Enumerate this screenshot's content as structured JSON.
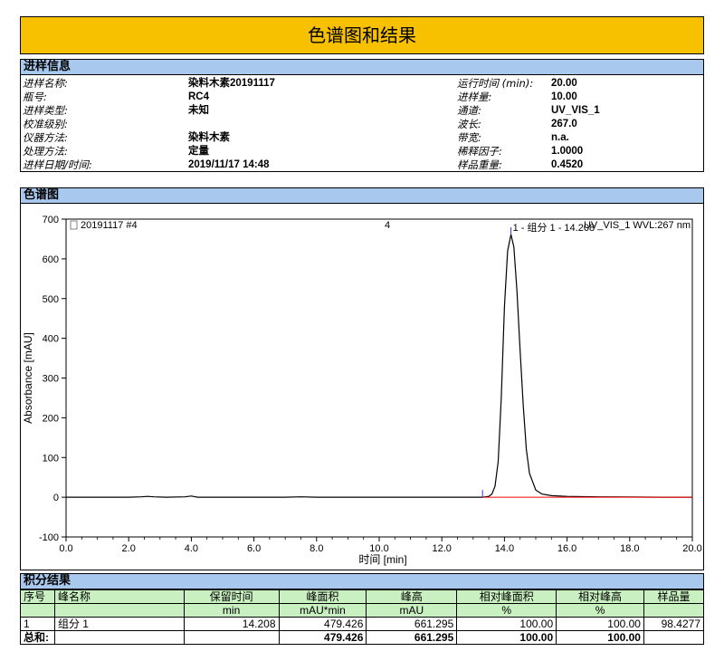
{
  "report": {
    "title": "色谱图和结果"
  },
  "sections": {
    "info": "进样信息",
    "chromatogram": "色谱图",
    "results": "积分结果"
  },
  "info": {
    "left": [
      {
        "label": "进样名称:",
        "value": "染料木素20191117"
      },
      {
        "label": "瓶号:",
        "value": "RC4"
      },
      {
        "label": "进样类型:",
        "value": "未知"
      },
      {
        "label": "校准级别:",
        "value": ""
      },
      {
        "label": "仪器方法:",
        "value": "染料木素"
      },
      {
        "label": "处理方法:",
        "value": "定量"
      },
      {
        "label": "进样日期/时间:",
        "value": "2019/11/17 14:48"
      }
    ],
    "right": [
      {
        "label": "运行时间 (min):",
        "value": "20.00"
      },
      {
        "label": "进样量:",
        "value": "10.00"
      },
      {
        "label": "通道:",
        "value": "UV_VIS_1"
      },
      {
        "label": "波长:",
        "value": "267.0"
      },
      {
        "label": "带宽:",
        "value": "n.a."
      },
      {
        "label": "稀释因子:",
        "value": "1.0000"
      },
      {
        "label": "样品重量:",
        "value": "0.4520"
      }
    ]
  },
  "chart_data": {
    "type": "line",
    "header_left": "20191117 #4",
    "header_center": "4",
    "header_right": "UV_VIS_1 WVL:267 nm",
    "xlabel": "时间 [min]",
    "ylabel": "Absorbance [mAU]",
    "xlim": [
      0.0,
      20.0
    ],
    "ylim": [
      -100,
      700
    ],
    "x_ticks": [
      "0.0",
      "2.0",
      "4.0",
      "6.0",
      "8.0",
      "10.0",
      "12.0",
      "14.0",
      "16.0",
      "18.0",
      "20.0"
    ],
    "y_ticks": [
      "-100",
      "0",
      "100",
      "200",
      "300",
      "400",
      "500",
      "600",
      "700"
    ],
    "series": [
      {
        "color": "#000000",
        "x": [
          0.0,
          2.0,
          2.4,
          2.6,
          2.8,
          3.2,
          3.8,
          4.0,
          4.2,
          5.0,
          7.0,
          7.5,
          8.0,
          10.0,
          12.0,
          13.0,
          13.3,
          13.5,
          13.6,
          13.7,
          13.8,
          13.9,
          14.0,
          14.1,
          14.208,
          14.3,
          14.4,
          14.5,
          14.6,
          14.7,
          14.8,
          15.0,
          15.2,
          15.5,
          16.0,
          17.0,
          18.0,
          19.0,
          20.0
        ],
        "y": [
          0,
          0,
          1,
          2,
          1,
          0,
          1,
          3,
          0,
          0,
          0,
          1,
          0,
          0,
          0,
          0,
          0,
          2,
          8,
          28,
          90,
          250,
          480,
          620,
          661.295,
          630,
          520,
          370,
          230,
          120,
          60,
          18,
          8,
          4,
          2,
          1,
          0.5,
          0,
          0
        ]
      },
      {
        "color": "#ff0000",
        "x": [
          13.3,
          20.0
        ],
        "y": [
          0,
          0
        ]
      }
    ],
    "peak_markers": [
      13.3,
      14.208
    ],
    "annotations": [
      {
        "x": 14.208,
        "y": 661.295,
        "text": "1 - 组分 1 - 14.208"
      }
    ]
  },
  "results": {
    "headers1": [
      "序号",
      "峰名称",
      "保留时间",
      "峰面积",
      "峰高",
      "相对峰面积",
      "相对峰高",
      "样品量"
    ],
    "headers2": [
      "",
      "",
      "min",
      "mAU*min",
      "mAU",
      "%",
      "%",
      ""
    ],
    "rows": [
      [
        "1",
        "组分 1",
        "14.208",
        "479.426",
        "661.295",
        "100.00",
        "100.00",
        "98.4277"
      ]
    ],
    "total": [
      "总和:",
      "",
      "",
      "479.426",
      "661.295",
      "100.00",
      "100.00",
      ""
    ]
  },
  "colors": {
    "title_bg": "#f7c100",
    "section_bg": "#a8c8ee",
    "table_header_bg": "#c8f0c0",
    "baseline": "#ff0000"
  }
}
